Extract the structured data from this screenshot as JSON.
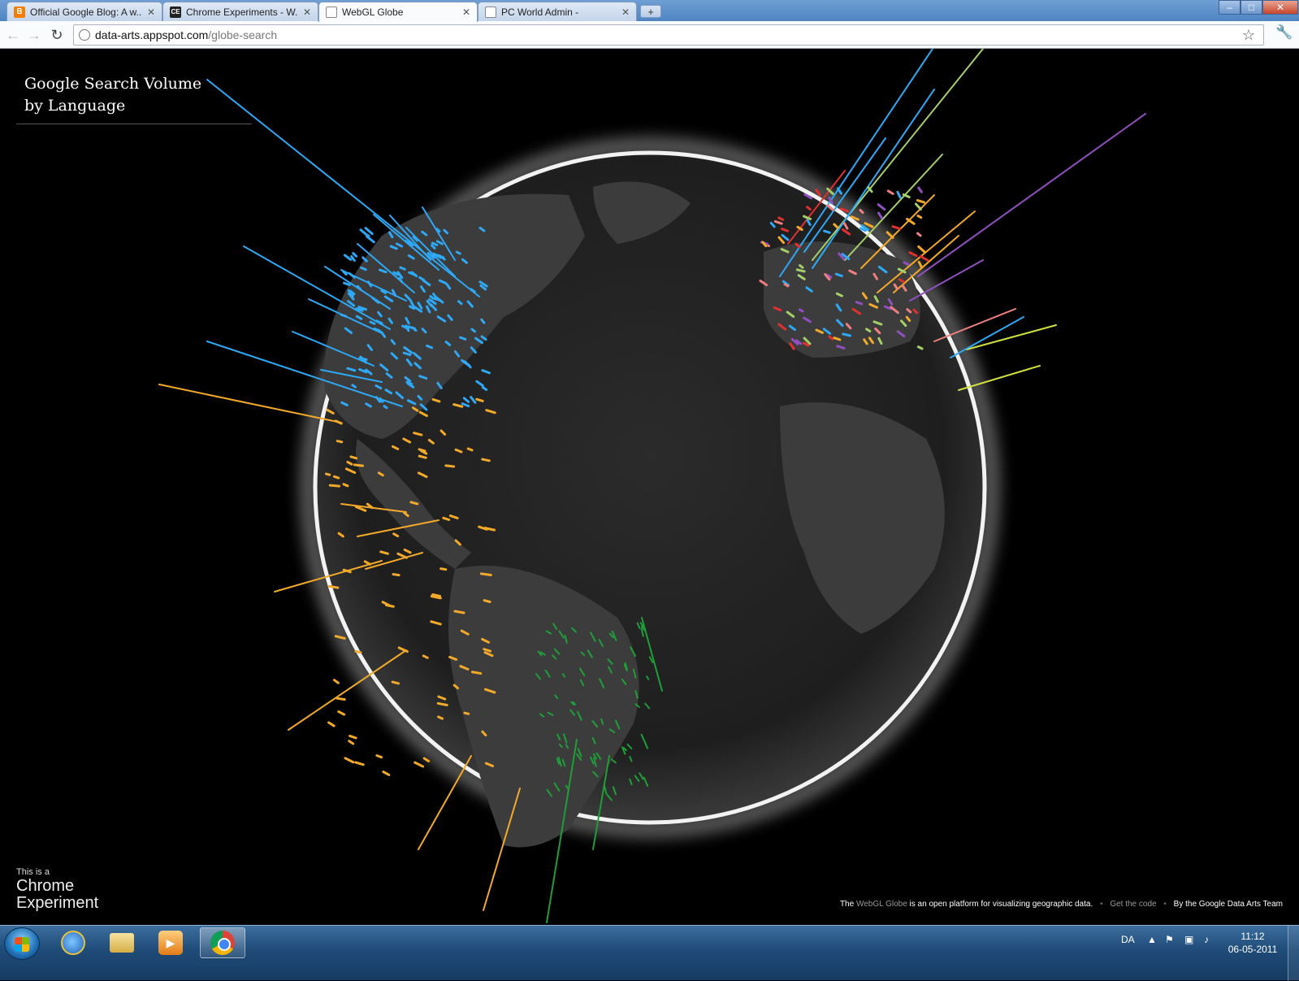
{
  "browser": {
    "tabs": [
      {
        "label": "Official Google Blog: A w...",
        "favicon": "blogger-icon"
      },
      {
        "label": "Chrome Experiments - W...",
        "favicon": "ce-icon"
      },
      {
        "label": "WebGL Globe",
        "favicon": "page-icon",
        "active": true
      },
      {
        "label": "PC World Admin -",
        "favicon": "page-icon"
      }
    ],
    "new_tab_label": "+",
    "window_buttons": {
      "minimize": "‒",
      "maximize": "□",
      "close": "✕"
    },
    "url_host": "data-arts.appspot.com",
    "url_path": "/globe-search"
  },
  "page": {
    "title_line1": "Google Search Volume",
    "title_line2": "by Language",
    "chrome_experiment_small": "This is a",
    "chrome_experiment_big": "Chrome Experiment",
    "footer_pre": "The ",
    "footer_link": "WebGL Globe",
    "footer_post": " is an open platform for visualizing geographic data.",
    "footer_code": "Get the code",
    "footer_team": "By the Google Data Arts Team",
    "colors": {
      "english": "#2fa8f5",
      "spanish": "#f3aa2a",
      "portuguese": "#1f9e3a",
      "german_french": "#a5cf6a",
      "russian": "#9050c0",
      "arabic": "#d0e040",
      "red": "#e03030",
      "pink": "#f08080"
    }
  },
  "taskbar": {
    "language": "DA",
    "time": "11:12",
    "date": "06-05-2011"
  }
}
